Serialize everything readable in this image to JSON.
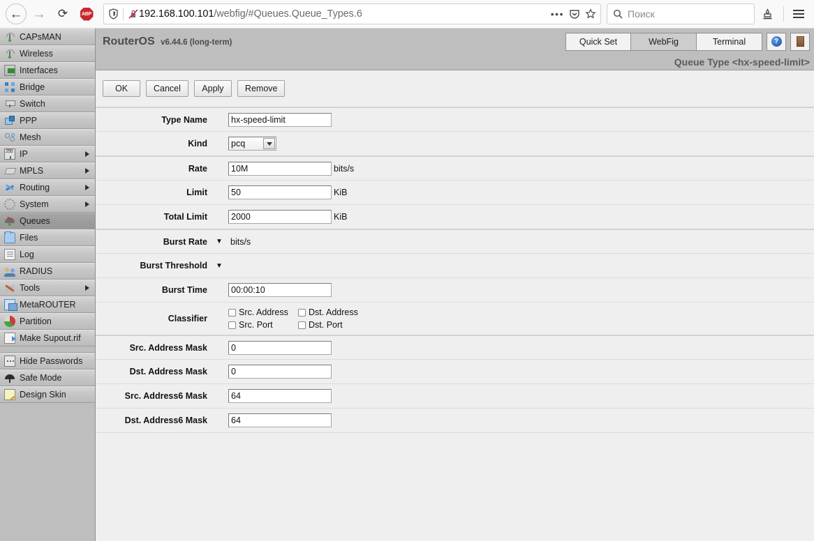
{
  "browser": {
    "back_icon": "back-arrow-icon",
    "forward_icon": "forward-arrow-icon",
    "reload_icon": "reload-icon",
    "adblock_label": "ABP",
    "shield_icon": "shield-icon",
    "insecure_icon": "crossed-lock-icon",
    "url_host": "192.168.100.101",
    "url_path": "/webfig/#Queues.Queue_Types.6",
    "page_actions_icon": "ellipsis-icon",
    "pocket_icon": "pocket-icon",
    "bookmark_star_icon": "star-icon",
    "search_placeholder": "Поиск",
    "search_icon": "search-icon",
    "library_icon": "library-icon",
    "menu_icon": "hamburger-menu-icon"
  },
  "sidebar": {
    "items": [
      {
        "label": "CAPsMAN",
        "icon": "capsman-icon",
        "arrow": false,
        "selected": false,
        "gap_before": false
      },
      {
        "label": "Wireless",
        "icon": "wireless-icon",
        "arrow": false,
        "selected": false,
        "gap_before": false
      },
      {
        "label": "Interfaces",
        "icon": "interfaces-icon",
        "arrow": false,
        "selected": false,
        "gap_before": false
      },
      {
        "label": "Bridge",
        "icon": "bridge-icon",
        "arrow": false,
        "selected": false,
        "gap_before": false
      },
      {
        "label": "Switch",
        "icon": "switch-icon",
        "arrow": false,
        "selected": false,
        "gap_before": false
      },
      {
        "label": "PPP",
        "icon": "ppp-icon",
        "arrow": false,
        "selected": false,
        "gap_before": false
      },
      {
        "label": "Mesh",
        "icon": "mesh-icon",
        "arrow": false,
        "selected": false,
        "gap_before": false
      },
      {
        "label": "IP",
        "icon": "ip-icon",
        "arrow": true,
        "selected": false,
        "gap_before": false
      },
      {
        "label": "MPLS",
        "icon": "mpls-icon",
        "arrow": true,
        "selected": false,
        "gap_before": false
      },
      {
        "label": "Routing",
        "icon": "routing-icon",
        "arrow": true,
        "selected": false,
        "gap_before": false
      },
      {
        "label": "System",
        "icon": "system-icon",
        "arrow": true,
        "selected": false,
        "gap_before": false
      },
      {
        "label": "Queues",
        "icon": "queues-icon",
        "arrow": false,
        "selected": true,
        "gap_before": false
      },
      {
        "label": "Files",
        "icon": "files-icon",
        "arrow": false,
        "selected": false,
        "gap_before": false
      },
      {
        "label": "Log",
        "icon": "log-icon",
        "arrow": false,
        "selected": false,
        "gap_before": false
      },
      {
        "label": "RADIUS",
        "icon": "radius-icon",
        "arrow": false,
        "selected": false,
        "gap_before": false
      },
      {
        "label": "Tools",
        "icon": "tools-icon",
        "arrow": true,
        "selected": false,
        "gap_before": false
      },
      {
        "label": "MetaROUTER",
        "icon": "metarouter-icon",
        "arrow": false,
        "selected": false,
        "gap_before": false
      },
      {
        "label": "Partition",
        "icon": "partition-icon",
        "arrow": false,
        "selected": false,
        "gap_before": false
      },
      {
        "label": "Make Supout.rif",
        "icon": "supout-icon",
        "arrow": false,
        "selected": false,
        "gap_before": false
      },
      {
        "label": "Hide Passwords",
        "icon": "hide-passwords-icon",
        "arrow": false,
        "selected": false,
        "gap_before": true
      },
      {
        "label": "Safe Mode",
        "icon": "safe-mode-icon",
        "arrow": false,
        "selected": false,
        "gap_before": false
      },
      {
        "label": "Design Skin",
        "icon": "design-skin-icon",
        "arrow": false,
        "selected": false,
        "gap_before": false
      }
    ]
  },
  "header": {
    "brand": "RouterOS",
    "version": "v6.44.6 (long-term)",
    "tabs": [
      {
        "label": "Quick Set",
        "active": false
      },
      {
        "label": "WebFig",
        "active": true
      },
      {
        "label": "Terminal",
        "active": false
      }
    ],
    "help_label": "?",
    "help_icon": "help-icon",
    "logout_icon": "logout-door-icon",
    "page_title": "Queue Type <hx-speed-limit>"
  },
  "toolbar": {
    "buttons": [
      {
        "label": "OK",
        "name": "ok-button"
      },
      {
        "label": "Cancel",
        "name": "cancel-button"
      },
      {
        "label": "Apply",
        "name": "apply-button"
      },
      {
        "label": "Remove",
        "name": "remove-button"
      }
    ]
  },
  "form": {
    "type_name": {
      "label": "Type Name",
      "value": "hx-speed-limit"
    },
    "kind": {
      "label": "Kind",
      "value": "pcq"
    },
    "rate": {
      "label": "Rate",
      "value": "10M",
      "unit": "bits/s"
    },
    "limit": {
      "label": "Limit",
      "value": "50",
      "unit": "KiB"
    },
    "total_limit": {
      "label": "Total Limit",
      "value": "2000",
      "unit": "KiB"
    },
    "burst_rate": {
      "label": "Burst Rate",
      "unit": "bits/s",
      "expand": "▼"
    },
    "burst_threshold": {
      "label": "Burst Threshold",
      "expand": "▼"
    },
    "burst_time": {
      "label": "Burst Time",
      "value": "00:00:10"
    },
    "classifier": {
      "label": "Classifier",
      "options": [
        {
          "label": "Src. Address",
          "checked": false
        },
        {
          "label": "Dst. Address",
          "checked": false
        },
        {
          "label": "Src. Port",
          "checked": false
        },
        {
          "label": "Dst. Port",
          "checked": false
        }
      ]
    },
    "src_address_mask": {
      "label": "Src. Address Mask",
      "value": "0"
    },
    "dst_address_mask": {
      "label": "Dst. Address Mask",
      "value": "0"
    },
    "src_address6_mask": {
      "label": "Src. Address6 Mask",
      "value": "64"
    },
    "dst_address6_mask": {
      "label": "Dst. Address6 Mask",
      "value": "64"
    }
  }
}
